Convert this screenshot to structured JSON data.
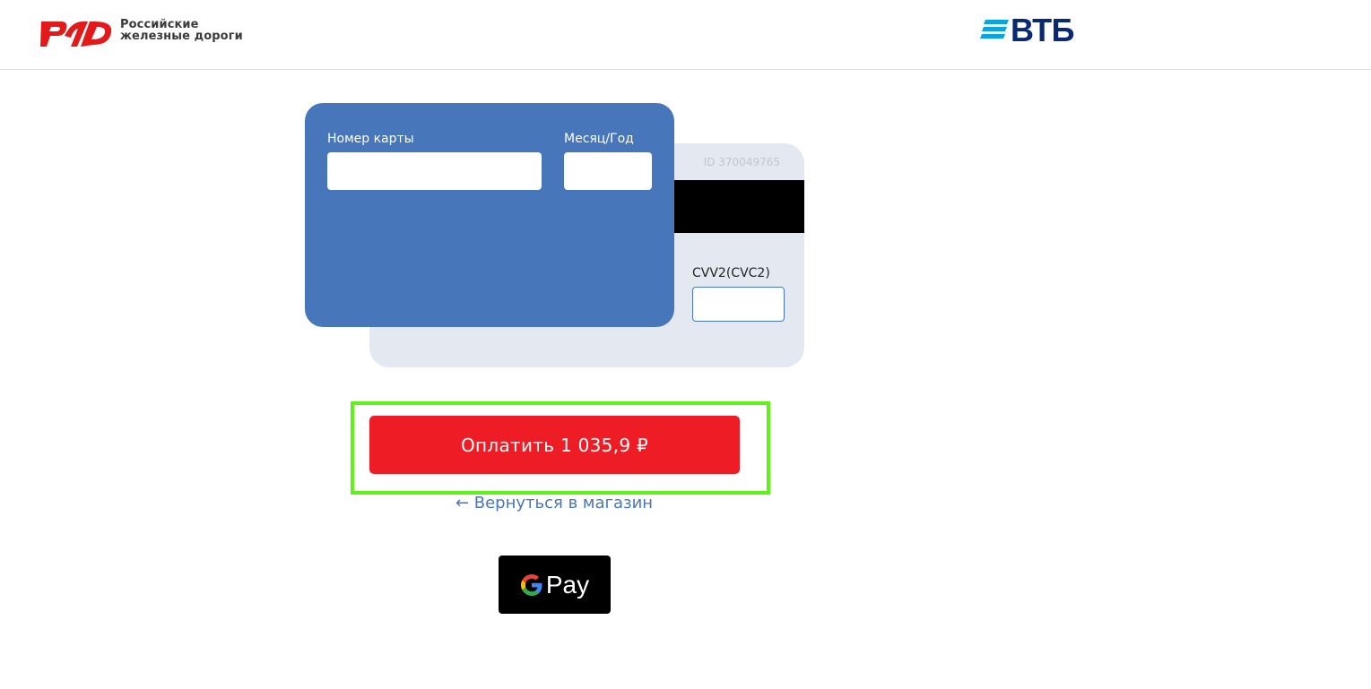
{
  "header": {
    "rzd_logo": {
      "line1": "Российские",
      "line2": "железные дороги"
    },
    "vtb_logo": {
      "text": "ВТБ"
    }
  },
  "card_form": {
    "card_number_label": "Номер карты",
    "card_number_value": "",
    "expiry_label": "Месяц/Год",
    "expiry_value": "",
    "cvv_label": "CVV2(CVC2)",
    "cvv_value": "",
    "card_id": "ID 370049765"
  },
  "actions": {
    "pay_button_label": "Оплатить 1 035,9 ₽",
    "back_link_label": "← Вернуться в магазин",
    "gpay_label": "Pay"
  },
  "colors": {
    "front_card": "#4876bb",
    "back_card": "#e4e9f1",
    "pay_button": "#ee1c25",
    "highlight": "#5ff21a",
    "link": "#4876bb"
  }
}
